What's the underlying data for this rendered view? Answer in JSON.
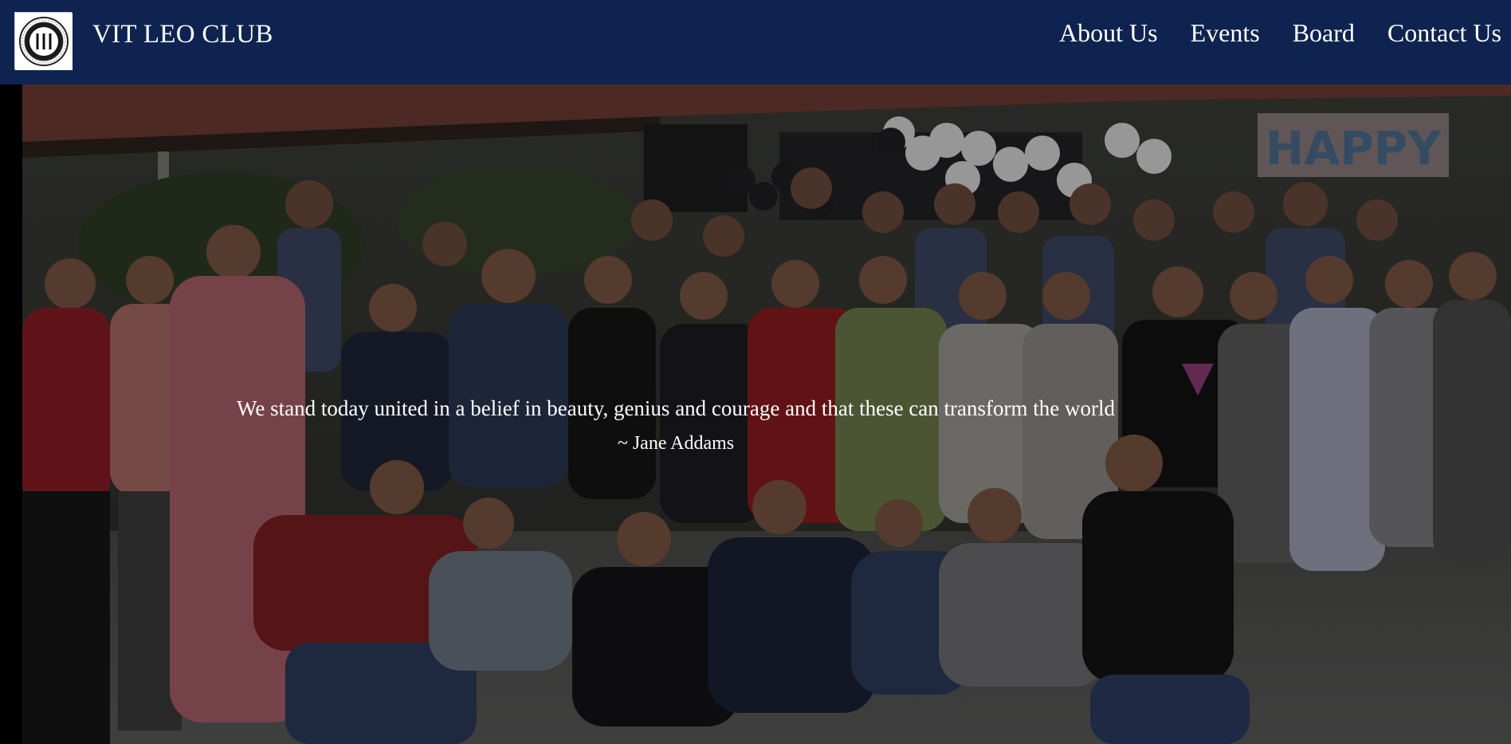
{
  "nav": {
    "logo_icon": "vit-university-leo-club-seal",
    "brand": "VIT LEO CLUB",
    "links": [
      "About Us",
      "Events",
      "Board",
      "Contact Us"
    ]
  },
  "hero": {
    "image": "group-photo-of-club-members",
    "banner_text": "HAPPY",
    "quote": "We stand today united in a belief in beauty, genius and courage and that these can transform the world",
    "author": "~ Jane Addams"
  },
  "colors": {
    "navbar_bg": "#0f2350",
    "text": "#ffffff"
  }
}
